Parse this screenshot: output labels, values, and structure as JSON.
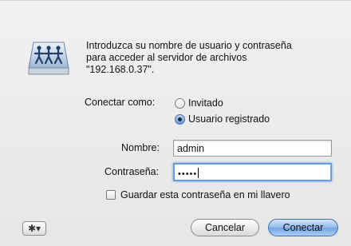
{
  "message": {
    "line1": "Introduzca su nombre de usuario y contraseña",
    "line2": "para acceder al servidor de archivos",
    "line3": "\"192.168.0.37\"."
  },
  "connect_as": {
    "label": "Conectar como:",
    "options": [
      "Invitado",
      "Usuario registrado"
    ],
    "selected": "Usuario registrado"
  },
  "form": {
    "name_label": "Nombre:",
    "name_value": "admin",
    "password_label": "Contraseña:",
    "password_mask": "•••••",
    "remember_label": "Guardar esta contraseña en mi llavero",
    "remember_checked": false
  },
  "buttons": {
    "gear_glyph": "✱▾",
    "cancel": "Cancelar",
    "connect": "Conectar"
  },
  "colors": {
    "accent": "#6a9de0"
  }
}
